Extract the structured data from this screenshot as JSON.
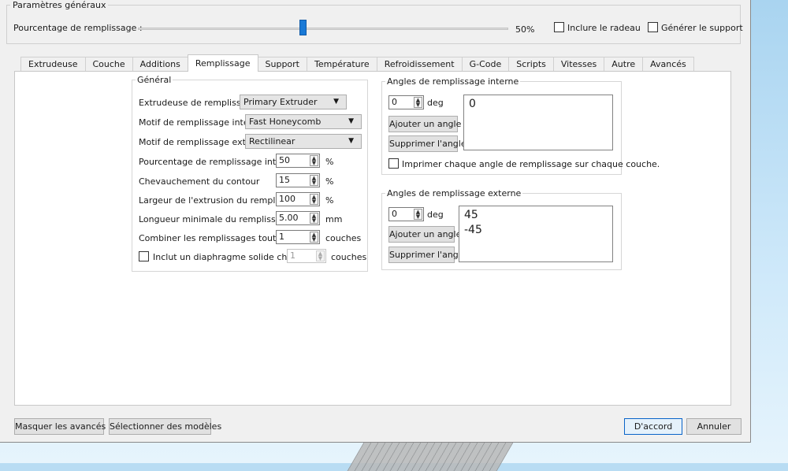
{
  "general": {
    "legend": "Paramètres généraux",
    "fill_label": "Pourcentage de remplissage :",
    "fill_value": "50%",
    "fill_slider_fraction": 0.5,
    "raft_label": "Inclure le radeau",
    "support_label": "Générer le support"
  },
  "tabs": [
    "Extrudeuse",
    "Couche",
    "Additions",
    "Remplissage",
    "Support",
    "Température",
    "Refroidissement",
    "G-Code",
    "Scripts",
    "Vitesses",
    "Autre",
    "Avancés"
  ],
  "infill": {
    "legend": "Général",
    "extruder_label": "Extrudeuse de remplissage",
    "extruder_value": "Primary Extruder",
    "inner_pattern_label": "Motif de remplissage interne",
    "inner_pattern_value": "Fast Honeycomb",
    "outer_pattern_label": "Motif de remplissage externe",
    "outer_pattern_value": "Rectilinear",
    "inner_pct_label": "Pourcentage de remplissage interne",
    "inner_pct_value": "50",
    "inner_pct_unit": "%",
    "overlap_label": "Chevauchement du contour",
    "overlap_value": "15",
    "overlap_unit": "%",
    "width_label": "Largeur de l'extrusion du remplissage",
    "width_value": "100",
    "width_unit": "%",
    "minlen_label": "Longueur minimale du remplissage",
    "minlen_value": "5.00",
    "minlen_unit": "mm",
    "combine_label": "Combiner les remplissages tout les",
    "combine_value": "1",
    "combine_unit": "couches",
    "diaphragm_label": "Inclut un diaphragme solide chaque",
    "diaphragm_value": "1",
    "diaphragm_unit": "couches"
  },
  "inner_angles": {
    "legend": "Angles de remplissage interne",
    "value": "0",
    "unit": "deg",
    "add_label": "Ajouter un angle",
    "remove_label": "Supprimer l'angle",
    "list": [
      "0"
    ],
    "print_each_label": "Imprimer chaque angle de remplissage sur chaque couche."
  },
  "outer_angles": {
    "legend": "Angles de remplissage externe",
    "value": "0",
    "unit": "deg",
    "add_label": "Ajouter un angle",
    "remove_label": "Supprimer l'angle",
    "list": [
      "45",
      "-45"
    ]
  },
  "footer": {
    "hide_advanced": "Masquer les avancés",
    "select_models": "Sélectionner des modèles",
    "ok": "D'accord",
    "cancel": "Annuler"
  }
}
